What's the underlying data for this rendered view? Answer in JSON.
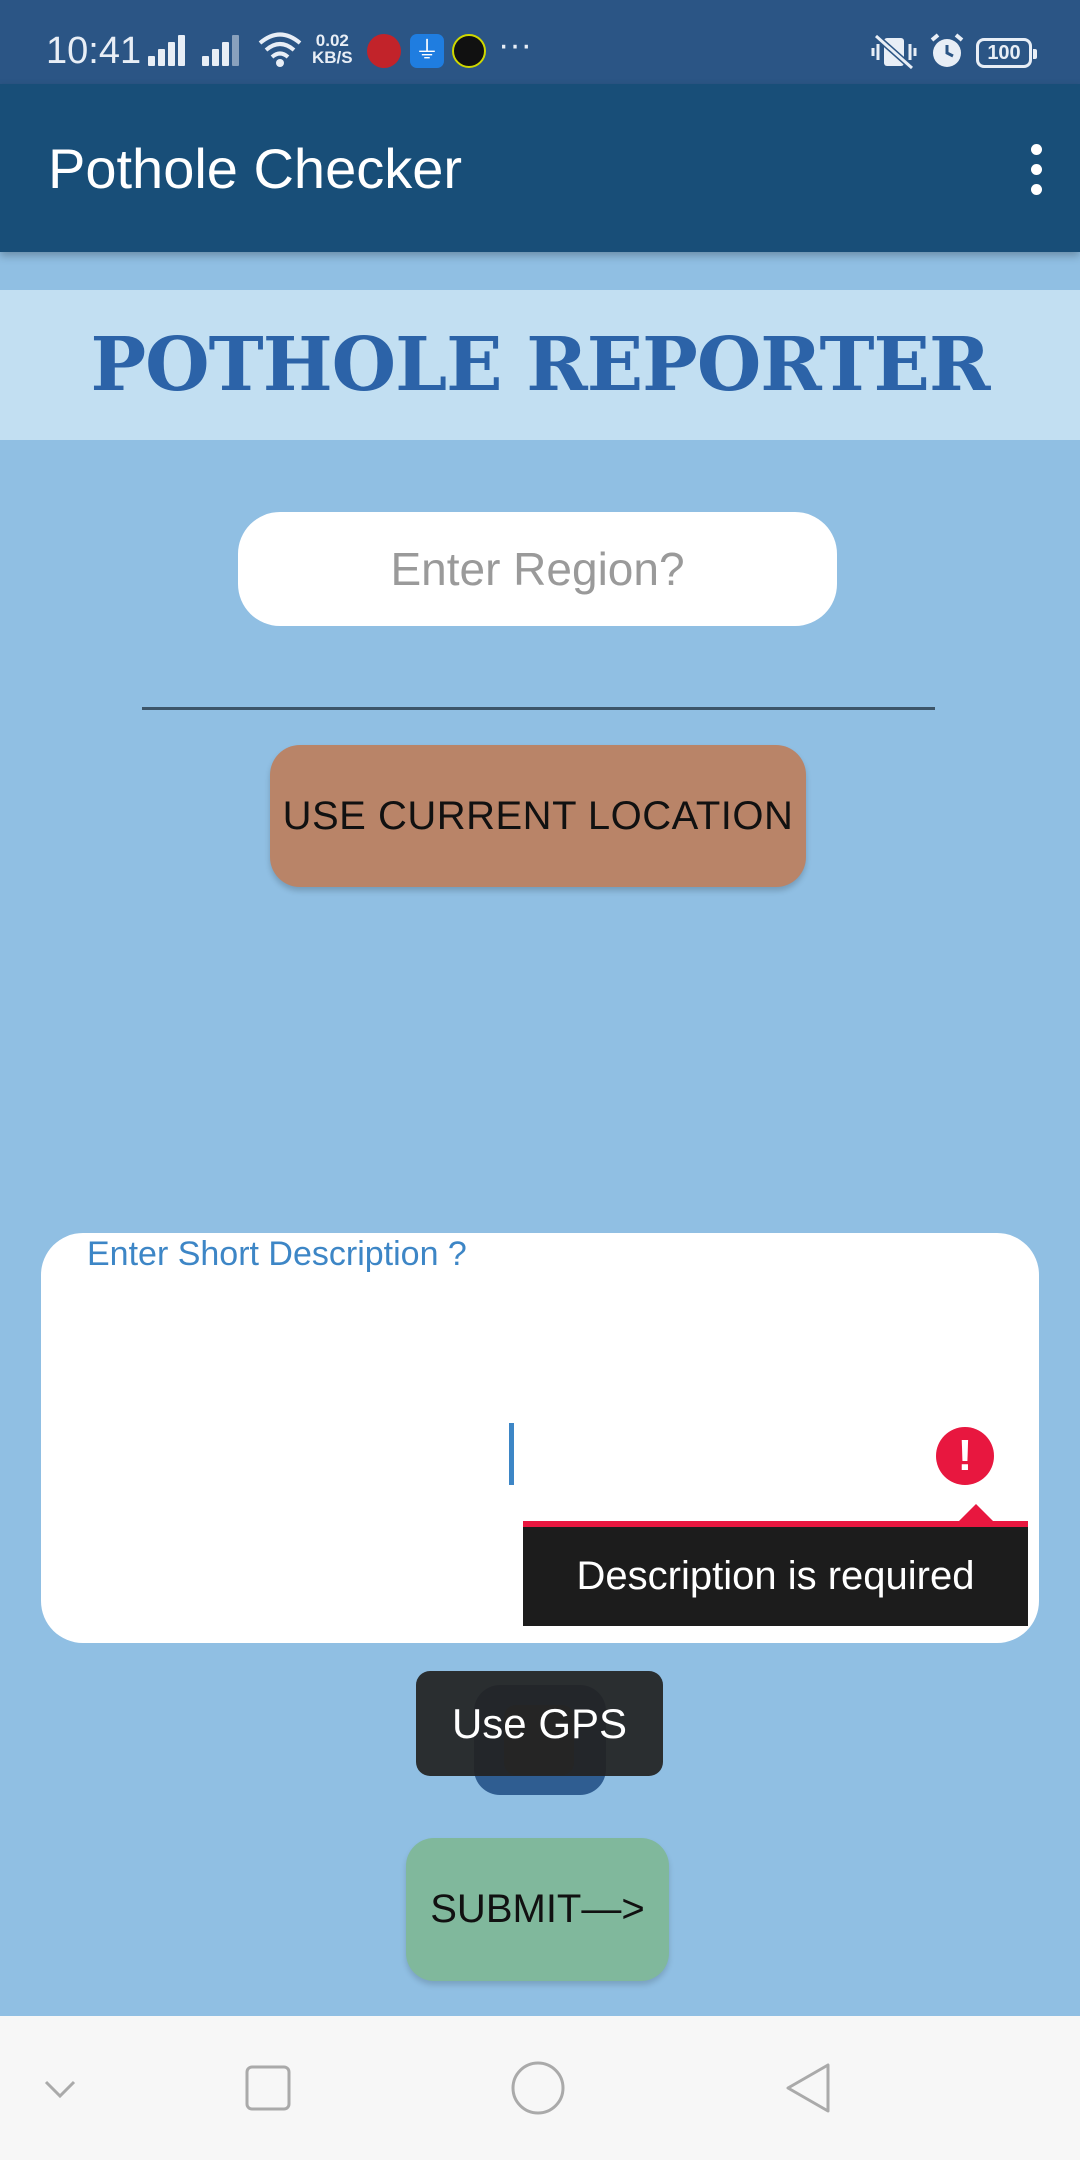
{
  "status_bar": {
    "time": "10:41",
    "net_speed_value": "0.02",
    "net_speed_unit": "KB/S",
    "more": "···",
    "battery": "100"
  },
  "app_bar": {
    "title": "Pothole Checker"
  },
  "banner": {
    "title": "POTHOLE REPORTER"
  },
  "region": {
    "placeholder": "Enter Region?",
    "value": ""
  },
  "location_button": {
    "label": "USE CURRENT LOCATION"
  },
  "description": {
    "label": "Enter Short Description ?",
    "value": "",
    "error": "Description is required"
  },
  "gps_toast": {
    "text": "Use GPS"
  },
  "submit_button": {
    "label": "SUBMIT—>"
  },
  "colors": {
    "status_bar": "#2b5585",
    "app_bar": "#184e78",
    "background": "#90bfe3",
    "banner": "#c2dff2",
    "title_text": "#2c63a8",
    "location_button": "#b98468",
    "submit_button": "#80b89c",
    "error": "#e8173f"
  },
  "icons": {
    "status": [
      "signal-icon",
      "wifi-icon",
      "usb-icon",
      "mute-vibrate-icon",
      "alarm-icon",
      "battery-icon"
    ],
    "app_bar": [
      "overflow-menu-icon"
    ],
    "navigation": [
      "collapse-icon",
      "recents-icon",
      "home-icon",
      "back-icon"
    ]
  }
}
